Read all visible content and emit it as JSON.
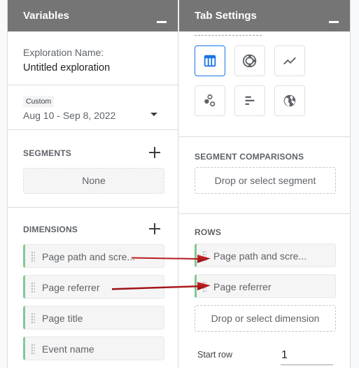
{
  "variables_panel": {
    "title": "Variables",
    "exploration_name_label": "Exploration Name:",
    "exploration_name_value": "Untitled exploration",
    "date_range": {
      "preset_label": "Custom",
      "value": "Aug 10 - Sep 8, 2022"
    },
    "segments": {
      "label": "SEGMENTS",
      "empty_value": "None"
    },
    "dimensions": {
      "label": "DIMENSIONS",
      "items": [
        {
          "label": "Page path and scre..."
        },
        {
          "label": "Page referrer"
        },
        {
          "label": "Page title"
        },
        {
          "label": "Event name"
        }
      ]
    }
  },
  "tab_settings_panel": {
    "title": "Tab Settings",
    "visualizations": [
      {
        "name": "table",
        "icon": "table-icon",
        "selected": true
      },
      {
        "name": "donut",
        "icon": "donut-chart-icon",
        "selected": false
      },
      {
        "name": "line",
        "icon": "line-chart-icon",
        "selected": false
      },
      {
        "name": "scatter",
        "icon": "scatter-plot-icon",
        "selected": false
      },
      {
        "name": "bar",
        "icon": "bar-chart-icon",
        "selected": false
      },
      {
        "name": "geo",
        "icon": "globe-icon",
        "selected": false
      }
    ],
    "segment_comparisons": {
      "label": "SEGMENT COMPARISONS",
      "drop_placeholder": "Drop or select segment"
    },
    "rows": {
      "label": "ROWS",
      "items": [
        {
          "label": "Page path and scre..."
        },
        {
          "label": "Page referrer"
        }
      ],
      "drop_placeholder": "Drop or select dimension",
      "start_row_label": "Start row",
      "start_row_value": "1"
    }
  },
  "colors": {
    "header_bg": "#757575",
    "accent_blue": "#1a73e8",
    "chip_green": "#81c995",
    "arrow_red": "#c0141b"
  }
}
